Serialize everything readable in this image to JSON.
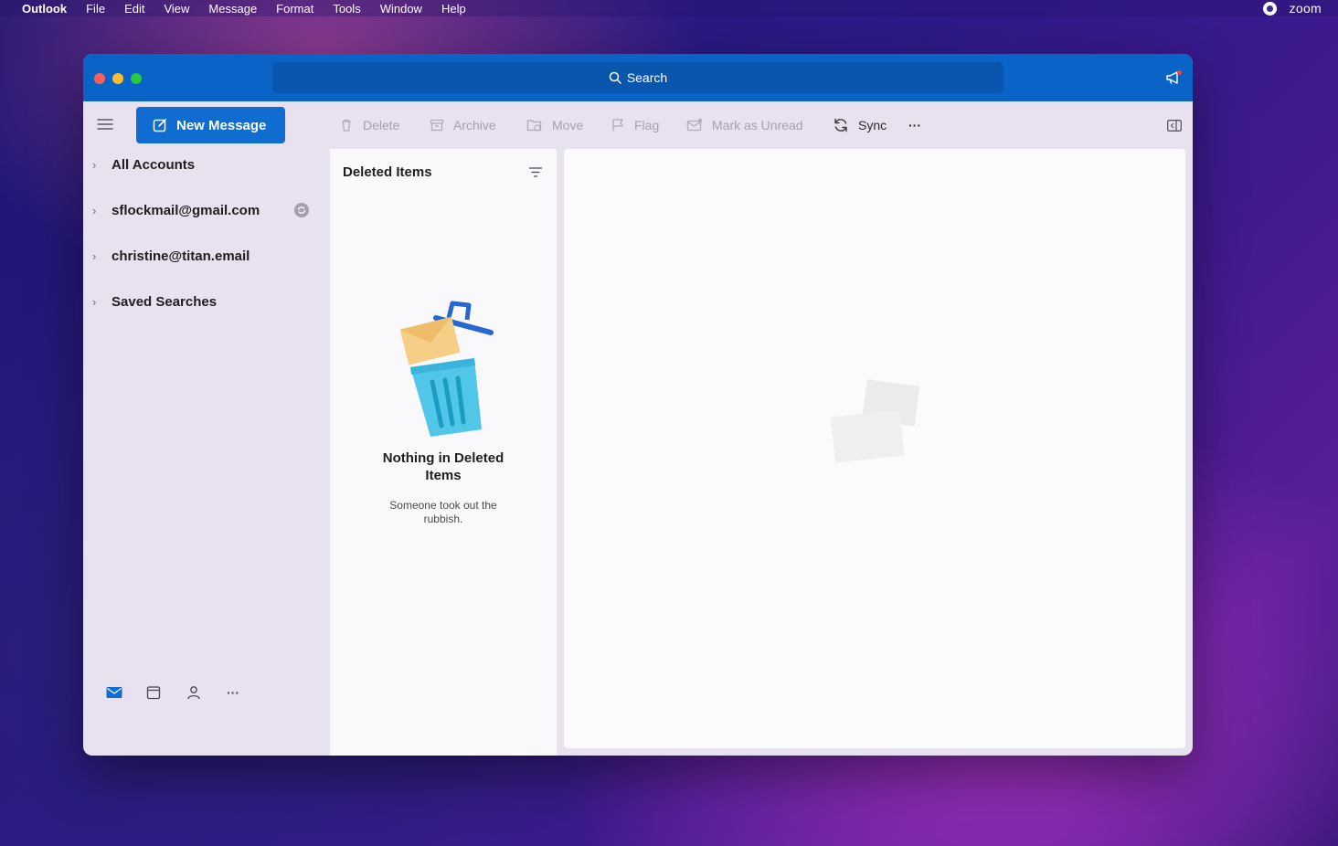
{
  "menubar": {
    "apple": "",
    "app_name": "Outlook",
    "items": [
      "File",
      "Edit",
      "View",
      "Message",
      "Format",
      "Tools",
      "Window",
      "Help"
    ],
    "zoom_label": "zoom"
  },
  "titlebar": {
    "search_label": "Search"
  },
  "toolbar": {
    "new_message": "New Message",
    "delete": "Delete",
    "archive": "Archive",
    "move": "Move",
    "flag": "Flag",
    "mark_unread": "Mark as Unread",
    "sync": "Sync",
    "more": "···"
  },
  "sidebar": {
    "accounts": [
      {
        "label": "All Accounts"
      },
      {
        "label": "sflockmail@gmail.com"
      },
      {
        "label": "christine@titan.email"
      },
      {
        "label": "Saved Searches"
      }
    ],
    "bottom_more": "···"
  },
  "message_list": {
    "folder_title": "Deleted Items",
    "empty_title": "Nothing in Deleted Items",
    "empty_subtitle": "Someone took out the rubbish."
  },
  "colors": {
    "titlebar": "#0a64c8",
    "accent": "#0f6cd0",
    "sidebar_bg": "#e8e1ef",
    "list_bg": "#f9f9fc"
  },
  "icons": {
    "search": "search-icon",
    "megaphone": "megaphone-icon",
    "hamburger": "hamburger-icon",
    "compose": "compose-icon",
    "delete": "trash-icon",
    "archive": "archive-icon",
    "move": "folder-move-icon",
    "flag": "flag-icon",
    "mark_unread": "envelope-icon",
    "sync": "sync-icon",
    "pane_toggle": "sidebar-toggle-icon",
    "filter": "filter-icon",
    "mail": "mail-icon",
    "calendar": "calendar-icon",
    "people": "people-icon"
  }
}
